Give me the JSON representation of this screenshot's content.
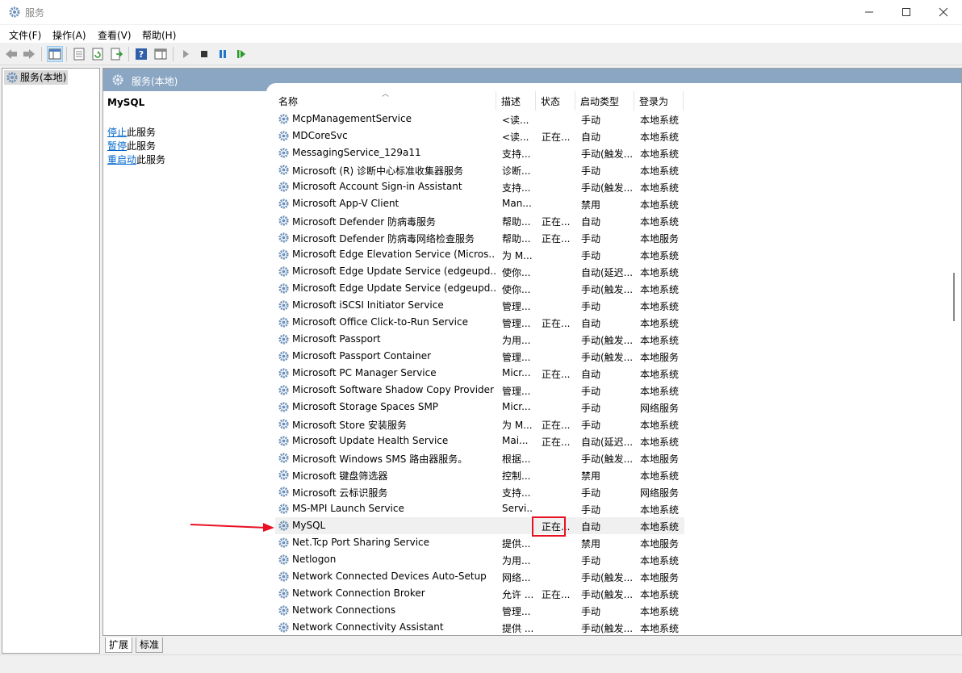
{
  "window": {
    "title": "服务"
  },
  "menu": [
    "文件(F)",
    "操作(A)",
    "查看(V)",
    "帮助(H)"
  ],
  "tree": {
    "root": "服务(本地)"
  },
  "pane": {
    "header": "服务(本地)",
    "selected_service": "MySQL",
    "actions": [
      {
        "link": "停止",
        "suffix": "此服务"
      },
      {
        "link": "暂停",
        "suffix": "此服务"
      },
      {
        "link": "重启动",
        "suffix": "此服务"
      }
    ]
  },
  "columns": [
    "名称",
    "描述",
    "状态",
    "启动类型",
    "登录为"
  ],
  "services": [
    {
      "name": "McpManagementService",
      "desc": "<读...",
      "status": "",
      "start": "手动",
      "logon": "本地系统"
    },
    {
      "name": "MDCoreSvc",
      "desc": "<读...",
      "status": "正在...",
      "start": "自动",
      "logon": "本地系统"
    },
    {
      "name": "MessagingService_129a11",
      "desc": "支持...",
      "status": "",
      "start": "手动(触发...",
      "logon": "本地系统"
    },
    {
      "name": "Microsoft (R) 诊断中心标准收集器服务",
      "desc": "诊断...",
      "status": "",
      "start": "手动",
      "logon": "本地系统"
    },
    {
      "name": "Microsoft Account Sign-in Assistant",
      "desc": "支持...",
      "status": "",
      "start": "手动(触发...",
      "logon": "本地系统"
    },
    {
      "name": "Microsoft App-V Client",
      "desc": "Man...",
      "status": "",
      "start": "禁用",
      "logon": "本地系统"
    },
    {
      "name": "Microsoft Defender 防病毒服务",
      "desc": "帮助...",
      "status": "正在...",
      "start": "自动",
      "logon": "本地系统"
    },
    {
      "name": "Microsoft Defender 防病毒网络检查服务",
      "desc": "帮助...",
      "status": "正在...",
      "start": "手动",
      "logon": "本地服务"
    },
    {
      "name": "Microsoft Edge Elevation Service (Micros...",
      "desc": "为 M...",
      "status": "",
      "start": "手动",
      "logon": "本地系统"
    },
    {
      "name": "Microsoft Edge Update Service (edgeupd...",
      "desc": "使你...",
      "status": "",
      "start": "自动(延迟...",
      "logon": "本地系统"
    },
    {
      "name": "Microsoft Edge Update Service (edgeupd...",
      "desc": "使你...",
      "status": "",
      "start": "手动(触发...",
      "logon": "本地系统"
    },
    {
      "name": "Microsoft iSCSI Initiator Service",
      "desc": "管理...",
      "status": "",
      "start": "手动",
      "logon": "本地系统"
    },
    {
      "name": "Microsoft Office Click-to-Run Service",
      "desc": "管理...",
      "status": "正在...",
      "start": "自动",
      "logon": "本地系统"
    },
    {
      "name": "Microsoft Passport",
      "desc": "为用...",
      "status": "",
      "start": "手动(触发...",
      "logon": "本地系统"
    },
    {
      "name": "Microsoft Passport Container",
      "desc": "管理...",
      "status": "",
      "start": "手动(触发...",
      "logon": "本地服务"
    },
    {
      "name": "Microsoft PC Manager Service",
      "desc": "Micr...",
      "status": "正在...",
      "start": "自动",
      "logon": "本地系统"
    },
    {
      "name": "Microsoft Software Shadow Copy Provider",
      "desc": "管理...",
      "status": "",
      "start": "手动",
      "logon": "本地系统"
    },
    {
      "name": "Microsoft Storage Spaces SMP",
      "desc": "Micr...",
      "status": "",
      "start": "手动",
      "logon": "网络服务"
    },
    {
      "name": "Microsoft Store 安装服务",
      "desc": "为 M...",
      "status": "正在...",
      "start": "手动",
      "logon": "本地系统"
    },
    {
      "name": "Microsoft Update Health Service",
      "desc": "Mai...",
      "status": "正在...",
      "start": "自动(延迟...",
      "logon": "本地系统"
    },
    {
      "name": "Microsoft Windows SMS 路由器服务。",
      "desc": "根据...",
      "status": "",
      "start": "手动(触发...",
      "logon": "本地服务"
    },
    {
      "name": "Microsoft 键盘筛选器",
      "desc": "控制...",
      "status": "",
      "start": "禁用",
      "logon": "本地系统"
    },
    {
      "name": "Microsoft 云标识服务",
      "desc": "支持...",
      "status": "",
      "start": "手动",
      "logon": "网络服务"
    },
    {
      "name": "MS-MPI Launch Service",
      "desc": "Servi...",
      "status": "",
      "start": "手动",
      "logon": "本地系统"
    },
    {
      "name": "MySQL",
      "desc": "",
      "status": "正在...",
      "start": "自动",
      "logon": "本地系统"
    },
    {
      "name": "Net.Tcp Port Sharing Service",
      "desc": "提供...",
      "status": "",
      "start": "禁用",
      "logon": "本地服务"
    },
    {
      "name": "Netlogon",
      "desc": "为用...",
      "status": "",
      "start": "手动",
      "logon": "本地系统"
    },
    {
      "name": "Network Connected Devices Auto-Setup",
      "desc": "网络...",
      "status": "",
      "start": "手动(触发...",
      "logon": "本地服务"
    },
    {
      "name": "Network Connection Broker",
      "desc": "允许 ...",
      "status": "正在...",
      "start": "手动(触发...",
      "logon": "本地系统"
    },
    {
      "name": "Network Connections",
      "desc": "管理...",
      "status": "",
      "start": "手动",
      "logon": "本地系统"
    },
    {
      "name": "Network Connectivity Assistant",
      "desc": "提供 ...",
      "status": "",
      "start": "手动(触发...",
      "logon": "本地系统"
    }
  ],
  "tabs": [
    "扩展",
    "标准"
  ],
  "colors": {
    "header_bg": "#8aa6c3",
    "link": "#0066cc",
    "highlight": "#e81123"
  },
  "icons": [
    "services-gear-icon",
    "back-arrow-icon",
    "forward-arrow-icon",
    "play-icon",
    "stop-icon",
    "pause-icon",
    "restart-icon"
  ]
}
